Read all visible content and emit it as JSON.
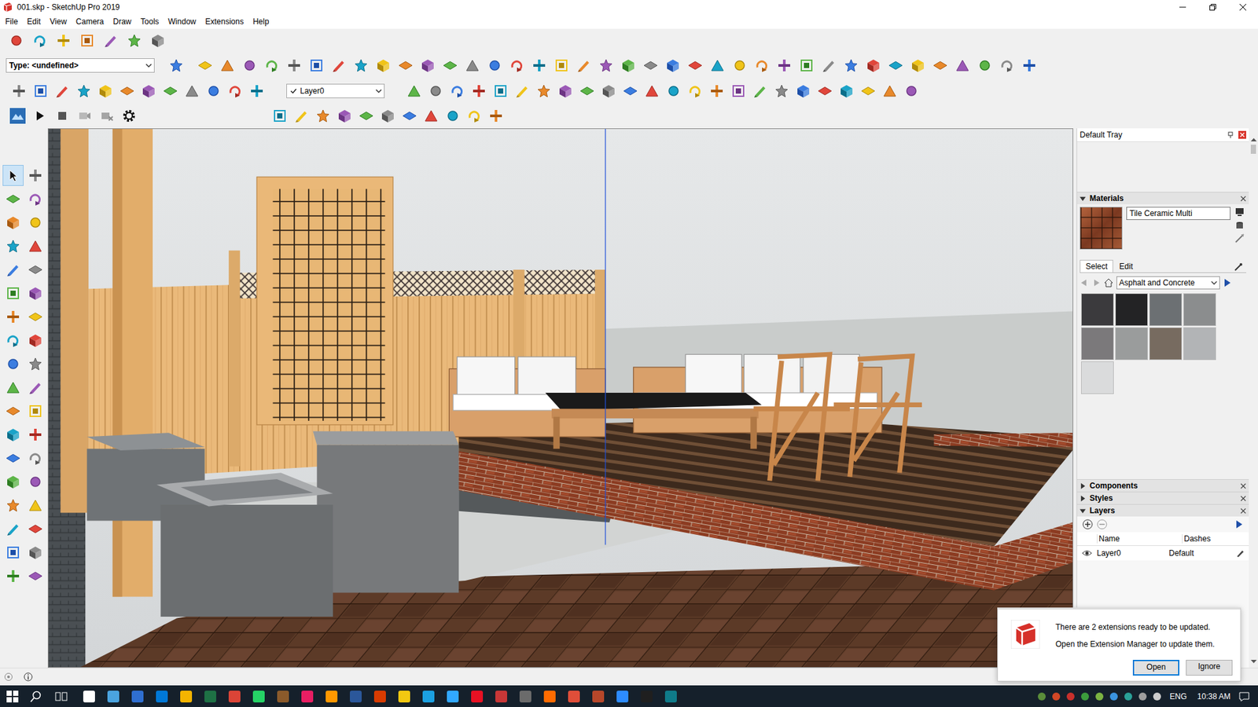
{
  "window": {
    "title": "001.skp - SketchUp Pro 2019"
  },
  "menu": [
    "File",
    "Edit",
    "View",
    "Camera",
    "Draw",
    "Tools",
    "Window",
    "Extensions",
    "Help"
  ],
  "toolbar": {
    "type_field": "Type: <undefined>",
    "layer_field": {
      "value": "Layer0",
      "checked": true
    }
  },
  "left_tools": [
    {
      "selected": true
    },
    {
      "selected": false
    },
    {
      "selected": false
    },
    {
      "selected": false
    },
    {
      "selected": false
    },
    {
      "selected": false
    },
    {
      "selected": false
    },
    {
      "selected": false
    },
    {
      "selected": false
    },
    {
      "selected": false
    },
    {
      "selected": false
    },
    {
      "selected": false
    },
    {
      "selected": false
    },
    {
      "selected": false
    },
    {
      "selected": false
    },
    {
      "selected": false
    },
    {
      "selected": false
    },
    {
      "selected": false
    },
    {
      "selected": false
    },
    {
      "selected": false
    },
    {
      "selected": false
    },
    {
      "selected": false
    },
    {
      "selected": false
    },
    {
      "selected": false
    },
    {
      "selected": false
    },
    {
      "selected": false
    },
    {
      "selected": false
    },
    {
      "selected": false
    },
    {
      "selected": false
    },
    {
      "selected": false
    },
    {
      "selected": false
    },
    {
      "selected": false
    },
    {
      "selected": false
    },
    {
      "selected": false
    },
    {
      "selected": false
    },
    {
      "selected": false
    }
  ],
  "tray": {
    "title": "Default Tray",
    "materials": {
      "title": "Materials",
      "expanded": true,
      "name": "Tile Ceramic Multi",
      "tabs": [
        {
          "label": "Select",
          "selected": true
        },
        {
          "label": "Edit",
          "selected": false
        }
      ],
      "library": "Asphalt and Concrete",
      "swatches": [
        {
          "color": "#3b3a3d"
        },
        {
          "color": "#232325"
        },
        {
          "color": "#6c7073"
        },
        {
          "color": "#8b8d8e"
        },
        {
          "color": "#7b797b"
        },
        {
          "color": "#9a9c9c"
        },
        {
          "color": "#776b60"
        },
        {
          "color": "#b2b4b6"
        },
        {
          "color": "#dadbdc"
        }
      ]
    },
    "sections": [
      {
        "title": "Components",
        "expanded": false
      },
      {
        "title": "Styles",
        "expanded": false
      }
    ],
    "layers": {
      "title": "Layers",
      "expanded": true,
      "columns": [
        "Name",
        "Dashes"
      ],
      "rows": [
        {
          "name": "Layer0",
          "dashes": "Default",
          "visible": true,
          "current": true
        }
      ]
    }
  },
  "notification": {
    "lines": [
      "There are 2 extensions ready to be updated.",
      "Open the Extension Manager to update them."
    ],
    "buttons": [
      {
        "label": "Open",
        "default": true
      },
      {
        "label": "Ignore",
        "default": false
      }
    ]
  },
  "taskbar": {
    "language": "ENG",
    "time": "10:38 AM"
  }
}
